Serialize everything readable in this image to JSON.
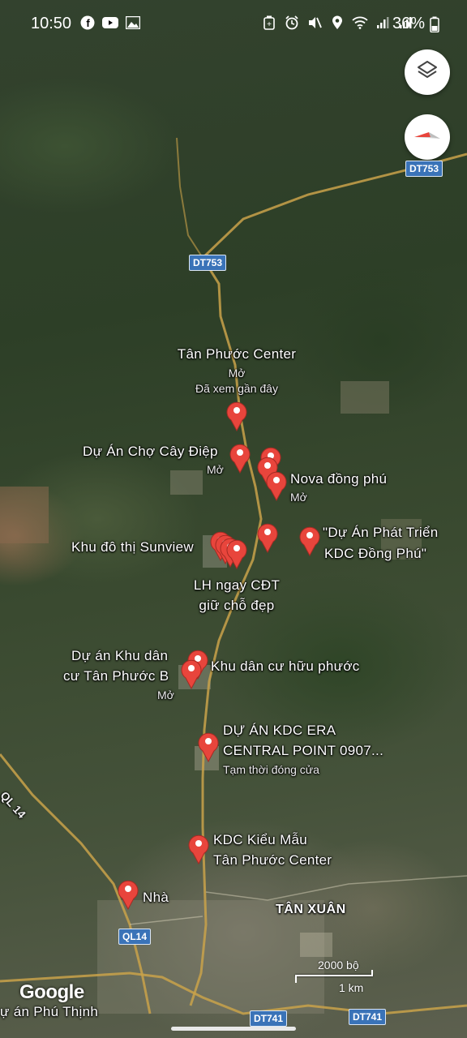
{
  "status_bar": {
    "time": "10:50",
    "battery": "36%",
    "left_icons": [
      "facebook-icon",
      "youtube-icon",
      "gallery-icon"
    ],
    "right_icons": [
      "battery-saver-icon",
      "alarm-icon",
      "mute-icon",
      "location-icon",
      "wifi-icon",
      "signal-icon",
      "signal-icon",
      "battery-icon"
    ]
  },
  "map_controls": {
    "layers_icon": "layers-icon",
    "compass_icon": "compass-icon"
  },
  "roads": {
    "dt753_top": "DT753",
    "dt753_mid": "DT753",
    "ql14_shield": "QL14",
    "ql14_label": "QL 14",
    "dt741_a": "DT741",
    "dt741_b": "DT741"
  },
  "places": {
    "tan_phuoc_center": {
      "name": "Tân Phước Center",
      "status": "Mở",
      "note": "Đã xem gần đây"
    },
    "cho_cay_diep": {
      "name": "Dự Án Chợ Cây Điệp",
      "status": "Mở"
    },
    "nova_dong_phu": {
      "name": "Nova đồng phú",
      "status": "Mở"
    },
    "phat_trien_line1": "\"Dự Án Phát Triển",
    "phat_trien_line2": "KDC Đồng Phú\"",
    "sunview": {
      "name": "Khu đô thị Sunview"
    },
    "lh_line1": "LH ngay CĐT",
    "lh_line2": "giữ chỗ đẹp",
    "tan_phuoc_b_line1": "Dự án Khu dân",
    "tan_phuoc_b_line2": "cư Tân Phước B",
    "tan_phuoc_b_status": "Mở",
    "huu_phuoc": "Khu dân cư hữu phước",
    "era_line1": "DỰ ÁN KDC ERA",
    "era_line2": "CENTRAL POINT 0907...",
    "era_status": "Tạm thời đóng cửa",
    "kieu_mau_line1": "KDC Kiểu Mẫu",
    "kieu_mau_line2": "Tân Phước Center",
    "nha": "Nhà",
    "phu_thinh": "ự án Phú Thịnh",
    "tan_xuan": "TÂN XUÂN"
  },
  "map_footer": {
    "logo": "Google",
    "scale_imperial": "2000 bộ",
    "scale_metric": "1 km"
  },
  "colors": {
    "pin": "#e8453c",
    "road": "#c9a24a",
    "shield": "#3a73b8"
  }
}
